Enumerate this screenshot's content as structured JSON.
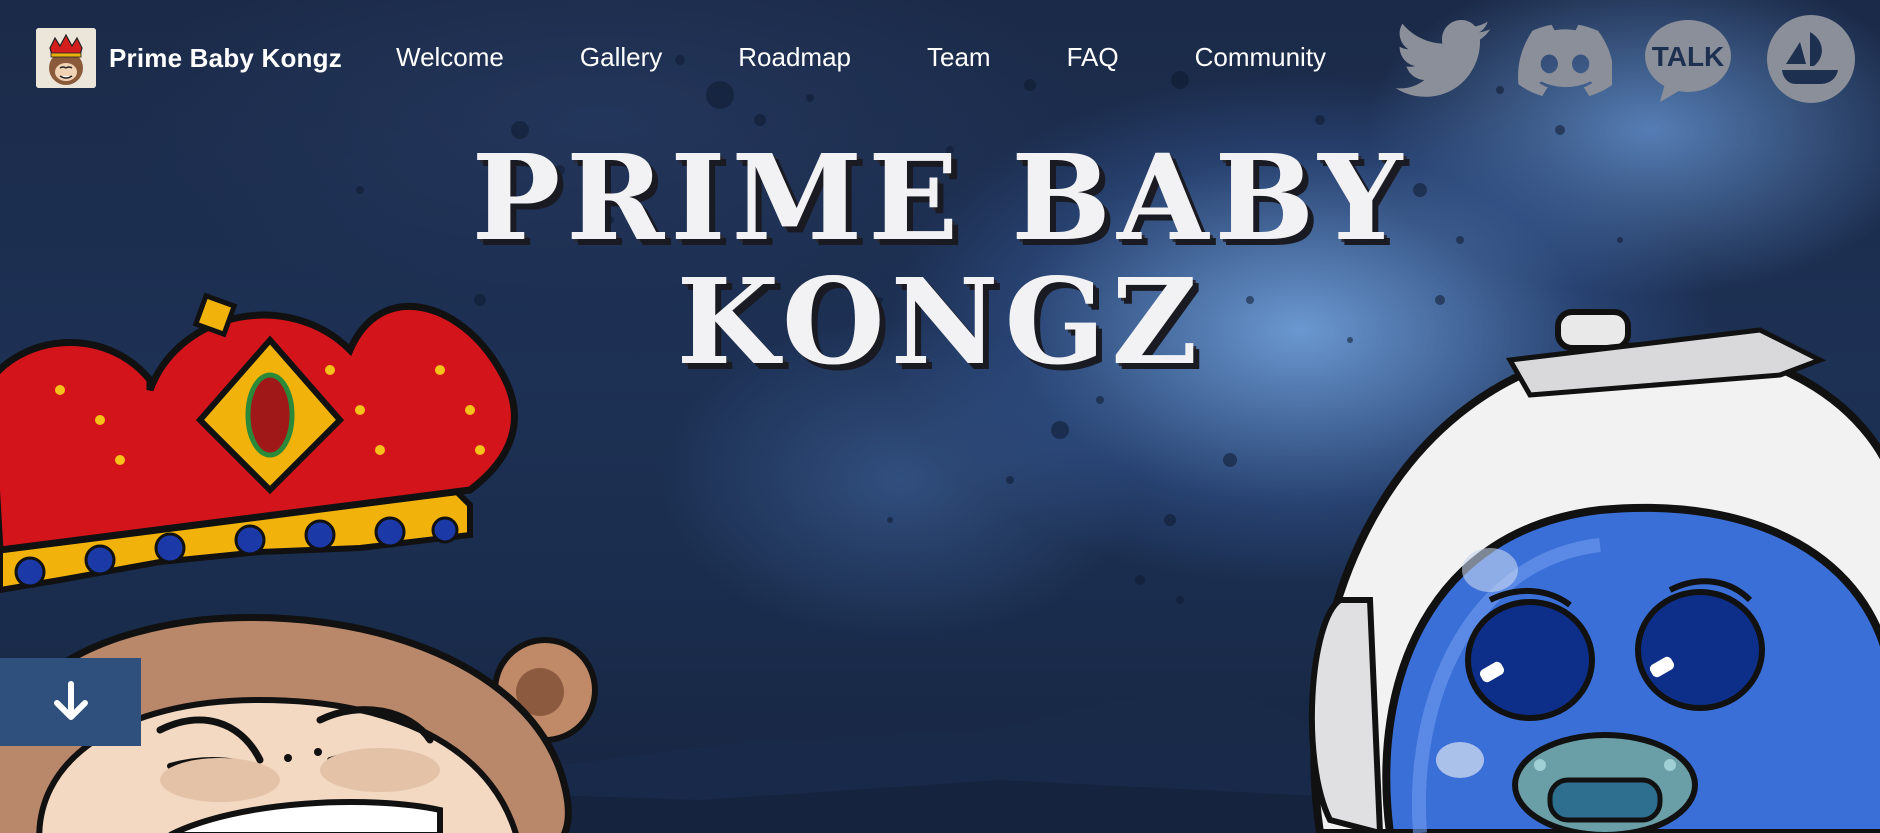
{
  "brand": {
    "name": "Prime Baby Kongz",
    "logo_icon": "baby-kong-avatar-icon"
  },
  "nav": {
    "items": [
      {
        "label": "Welcome"
      },
      {
        "label": "Gallery"
      },
      {
        "label": "Roadmap"
      },
      {
        "label": "Team"
      },
      {
        "label": "FAQ"
      },
      {
        "label": "Community"
      }
    ]
  },
  "socials": {
    "twitter_icon": "twitter-icon",
    "discord_icon": "discord-icon",
    "kakao_label": "TALK",
    "opensea_icon": "opensea-icon",
    "icon_color": "#8a8f99"
  },
  "hero": {
    "title_line_1": "PRIME BABY",
    "title_line_2": "KONGZ",
    "left_character": "crowned-baby-kong",
    "right_character": "astronaut-baby-kong"
  },
  "scroll_button": {
    "icon": "arrow-down-icon",
    "color": "#2f4f7d"
  },
  "colors": {
    "background": "#1d3155",
    "nav_text": "#ffffff",
    "title_text": "#f2f2f4"
  }
}
